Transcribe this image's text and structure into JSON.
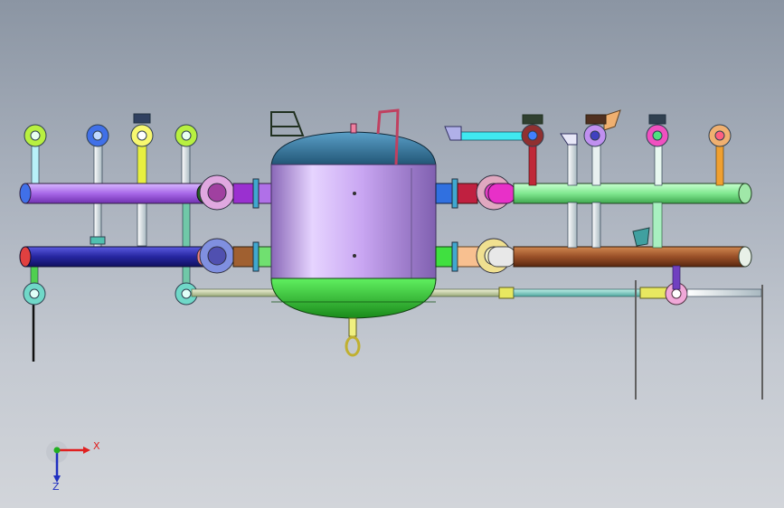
{
  "viewport": {
    "background_top": "#8b95a3",
    "background_bottom": "#d2d5da"
  },
  "triad": {
    "x_label": "X",
    "z_label": "Z",
    "x_color": "#e02020",
    "y_color": "#20b020",
    "z_color": "#2030c0"
  },
  "model": {
    "tank_body_color": "#c9a6f2",
    "tank_top_color": "#2a6f96",
    "tank_bottom_color": "#35d035",
    "pipe_colors": {
      "upper_left_header": "#b070e8",
      "lower_left_header": "#2828a0",
      "upper_right_header": "#80e890",
      "lower_right_header": "#9a5028",
      "bottom_line": "#c8d4a8"
    }
  }
}
